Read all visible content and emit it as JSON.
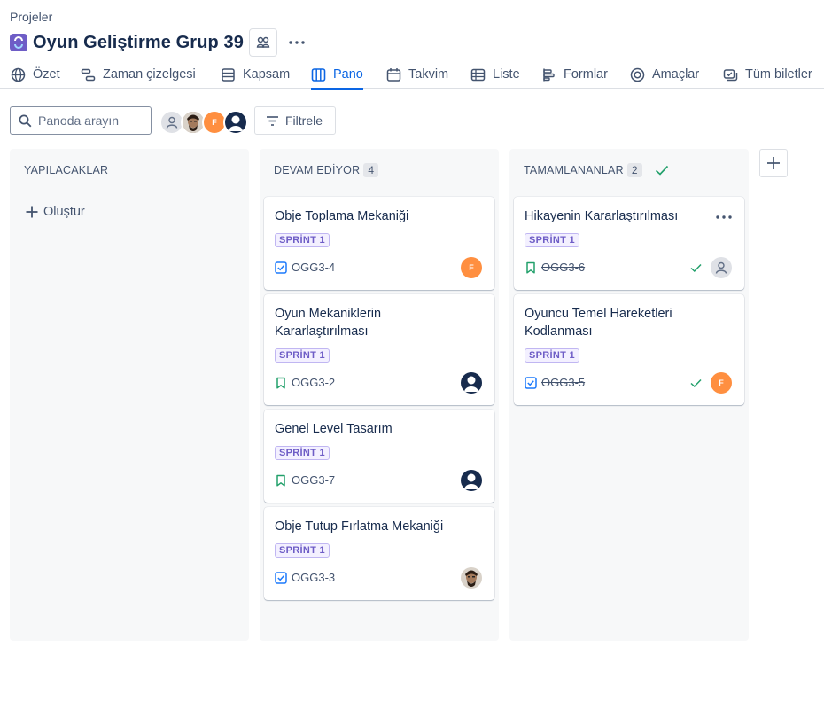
{
  "breadcrumb": "Projeler",
  "project": {
    "title": "Oyun Geliştirme Grup 39"
  },
  "tabs": [
    {
      "label": "Özet",
      "icon": "globe-icon"
    },
    {
      "label": "Zaman çizelgesi",
      "icon": "timeline-icon"
    },
    {
      "label": "Kapsam",
      "icon": "backlog-icon"
    },
    {
      "label": "Pano",
      "icon": "board-icon",
      "active": true
    },
    {
      "label": "Takvim",
      "icon": "calendar-icon"
    },
    {
      "label": "Liste",
      "icon": "list-icon"
    },
    {
      "label": "Formlar",
      "icon": "forms-icon"
    },
    {
      "label": "Amaçlar",
      "icon": "goals-icon"
    },
    {
      "label": "Tüm biletler",
      "icon": "tickets-icon"
    }
  ],
  "toolbar": {
    "search_placeholder": "Panoda arayın",
    "filter_label": "Filtrele",
    "avatar_letter": "F"
  },
  "columns": [
    {
      "name": "YAPILACAKLAR",
      "create_label": "Oluştur"
    },
    {
      "name": "DEVAM EDİYOR",
      "count": "4"
    },
    {
      "name": "TAMAMLANANLAR",
      "count": "2"
    }
  ],
  "cards": {
    "c1": {
      "title": "Obje Toplama Mekaniği",
      "sprint": "SPRİNT 1",
      "key": "OGG3-4",
      "type": "task",
      "assignee": "F"
    },
    "c2": {
      "title": "Oyun Mekaniklerin Kararlaştırılması",
      "sprint": "SPRİNT 1",
      "key": "OGG3-2",
      "type": "story"
    },
    "c3": {
      "title": "Genel Level Tasarım",
      "sprint": "SPRİNT 1",
      "key": "OGG3-7",
      "type": "story"
    },
    "c4": {
      "title": "Obje Tutup Fırlatma Mekaniği",
      "sprint": "SPRİNT 1",
      "key": "OGG3-3",
      "type": "task"
    },
    "c5": {
      "title": "Hikayenin Kararlaştırılması",
      "sprint": "SPRİNT 1",
      "key": "OGG3-6",
      "type": "story",
      "done": true
    },
    "c6": {
      "title": "Oyuncu Temel Hareketleri Kodlanması",
      "sprint": "SPRİNT 1",
      "key": "OGG3-5",
      "type": "task",
      "done": true,
      "assignee": "F"
    }
  },
  "colors": {
    "accent": "#0c66e4",
    "sprint_text": "#6e5dc6",
    "story_green": "#22a06b",
    "task_blue": "#1d7afc",
    "avatar_orange": "#ff8f40",
    "avatar_navy": "#172b4d"
  }
}
